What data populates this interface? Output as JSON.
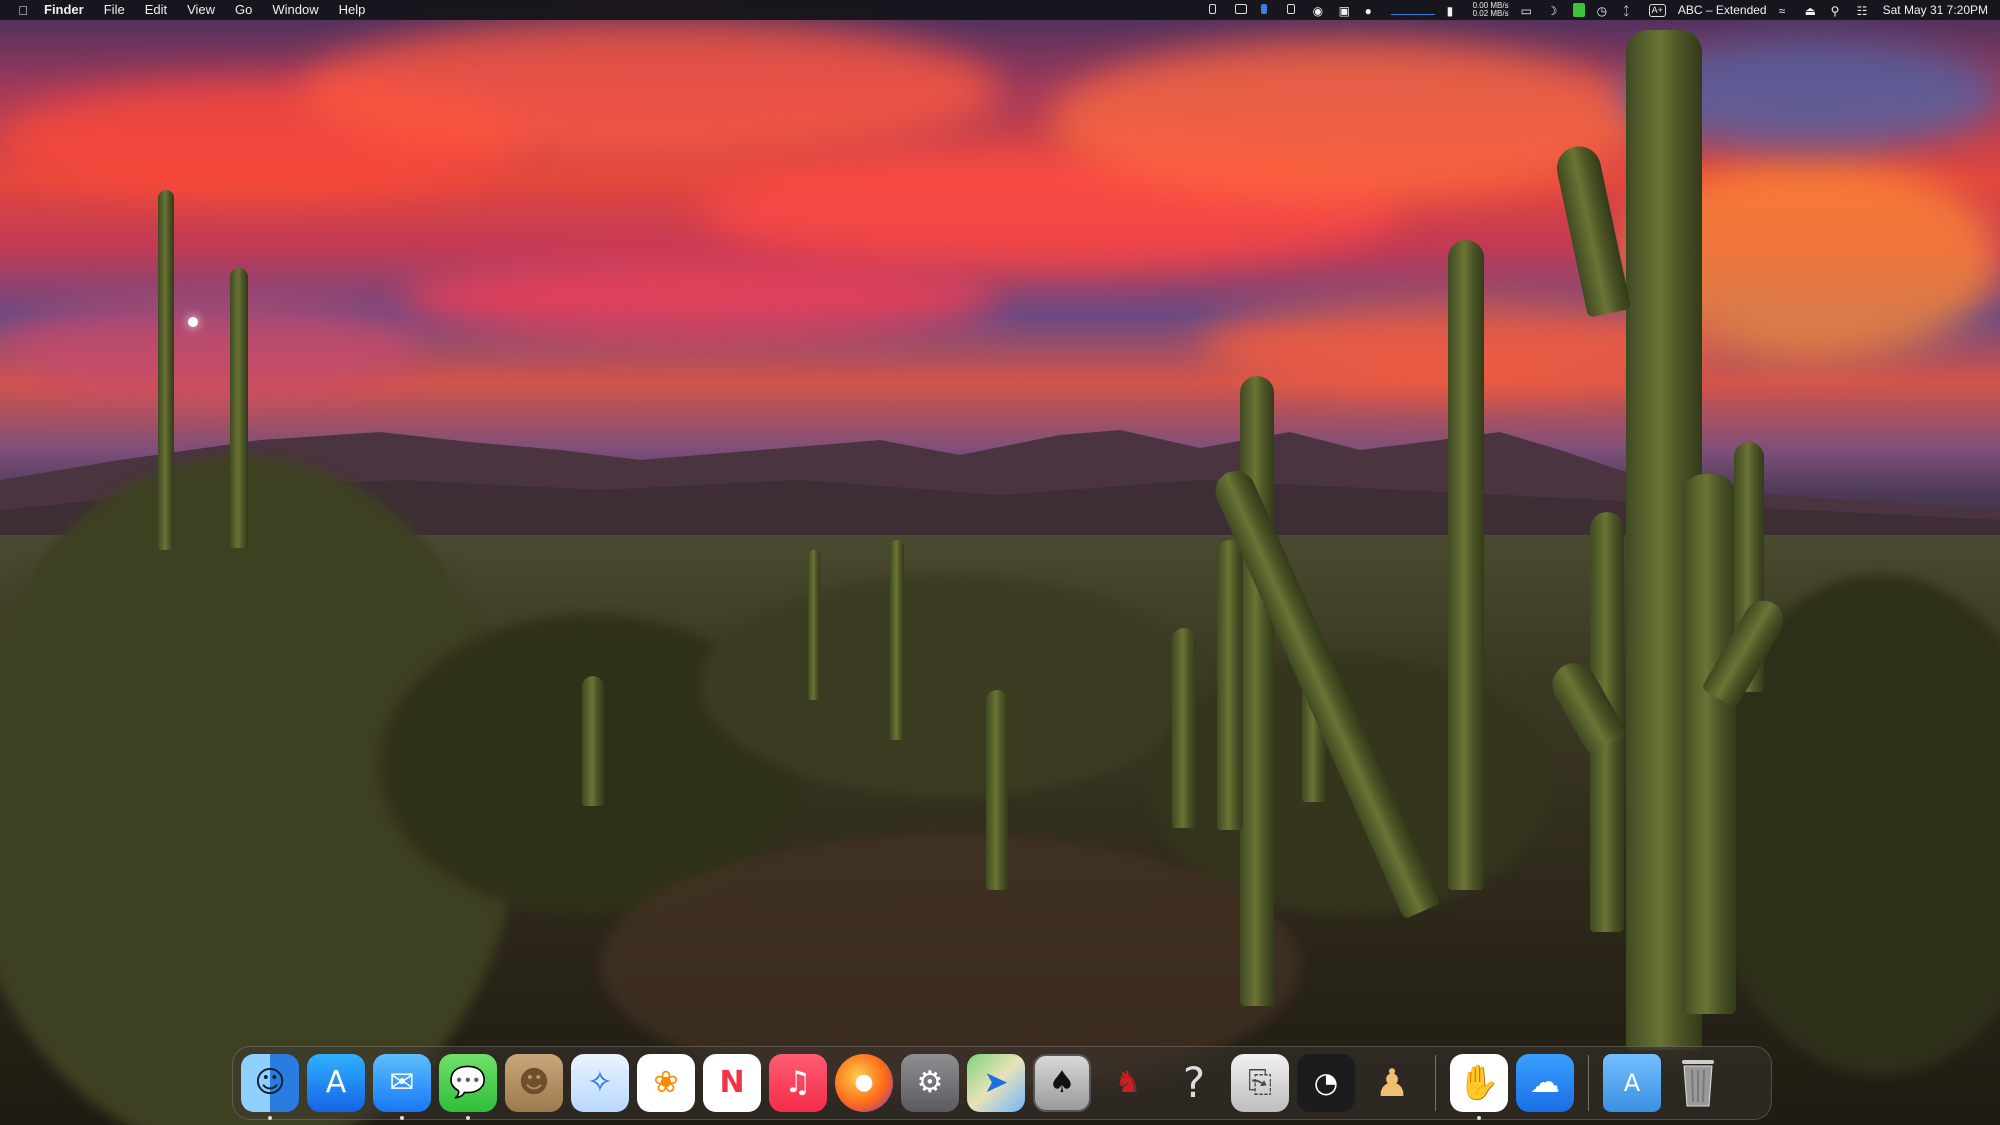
{
  "menubar": {
    "app_name": "Finder",
    "menus": [
      "File",
      "Edit",
      "View",
      "Go",
      "Window",
      "Help"
    ],
    "network_up": "0.00 MB/s",
    "network_down": "0.02 MB/s",
    "keyboard_badge": "A+",
    "input_source": "ABC – Extended",
    "datetime": "Sat May 31  7:20PM"
  },
  "dock": {
    "apps": [
      {
        "name": "Finder",
        "icon": "finder-icon",
        "running": true
      },
      {
        "name": "App Store",
        "icon": "app-store-icon",
        "running": false
      },
      {
        "name": "Mail",
        "icon": "mail-icon",
        "running": true
      },
      {
        "name": "Messages",
        "icon": "messages-icon",
        "running": true
      },
      {
        "name": "Contacts",
        "icon": "contacts-icon",
        "running": false
      },
      {
        "name": "Safari",
        "icon": "safari-icon",
        "running": false
      },
      {
        "name": "Photos",
        "icon": "photos-icon",
        "running": false
      },
      {
        "name": "News",
        "icon": "news-icon",
        "running": false
      },
      {
        "name": "Music",
        "icon": "music-icon",
        "running": false
      },
      {
        "name": "Firefox",
        "icon": "firefox-icon",
        "running": false
      },
      {
        "name": "System Settings",
        "icon": "system-settings-icon",
        "running": false
      },
      {
        "name": "Maps",
        "icon": "maps-icon",
        "running": false
      },
      {
        "name": "Solitaire",
        "icon": "solitaire-icon",
        "running": false
      },
      {
        "name": "Chess",
        "icon": "chess-icon",
        "running": false
      },
      {
        "name": "Tips",
        "icon": "help-icon",
        "running": false
      },
      {
        "name": "Printer",
        "icon": "printer-icon",
        "running": false
      },
      {
        "name": "Activity Monitor",
        "icon": "speedometer-icon",
        "running": false
      },
      {
        "name": "Family",
        "icon": "people-icon",
        "running": false
      },
      {
        "name": "Stop",
        "icon": "stop-hand-icon",
        "running": true
      },
      {
        "name": "Weather",
        "icon": "weather-icon",
        "running": false
      },
      {
        "name": "Applications",
        "icon": "applications-folder-icon",
        "running": false
      },
      {
        "name": "Trash",
        "icon": "trash-icon",
        "running": false
      }
    ]
  }
}
